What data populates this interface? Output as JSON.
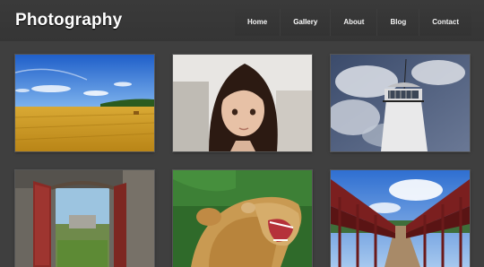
{
  "header": {
    "title": "Photography"
  },
  "nav": {
    "items": [
      {
        "label": "Home"
      },
      {
        "label": "Gallery",
        "active": true
      },
      {
        "label": "About"
      },
      {
        "label": "Blog"
      },
      {
        "label": "Contact"
      }
    ]
  },
  "gallery": {
    "photos": [
      {
        "subject": "wheat field under blue sky"
      },
      {
        "subject": "portrait of a young girl"
      },
      {
        "subject": "lighthouse against cloudy sky"
      },
      {
        "subject": "open red wooden door in stone wall"
      },
      {
        "subject": "roaring lion"
      },
      {
        "subject": "wooden footbridge"
      }
    ]
  },
  "colors": {
    "background": "#3f3f3f",
    "header": "#363636",
    "text": "#ffffff"
  }
}
